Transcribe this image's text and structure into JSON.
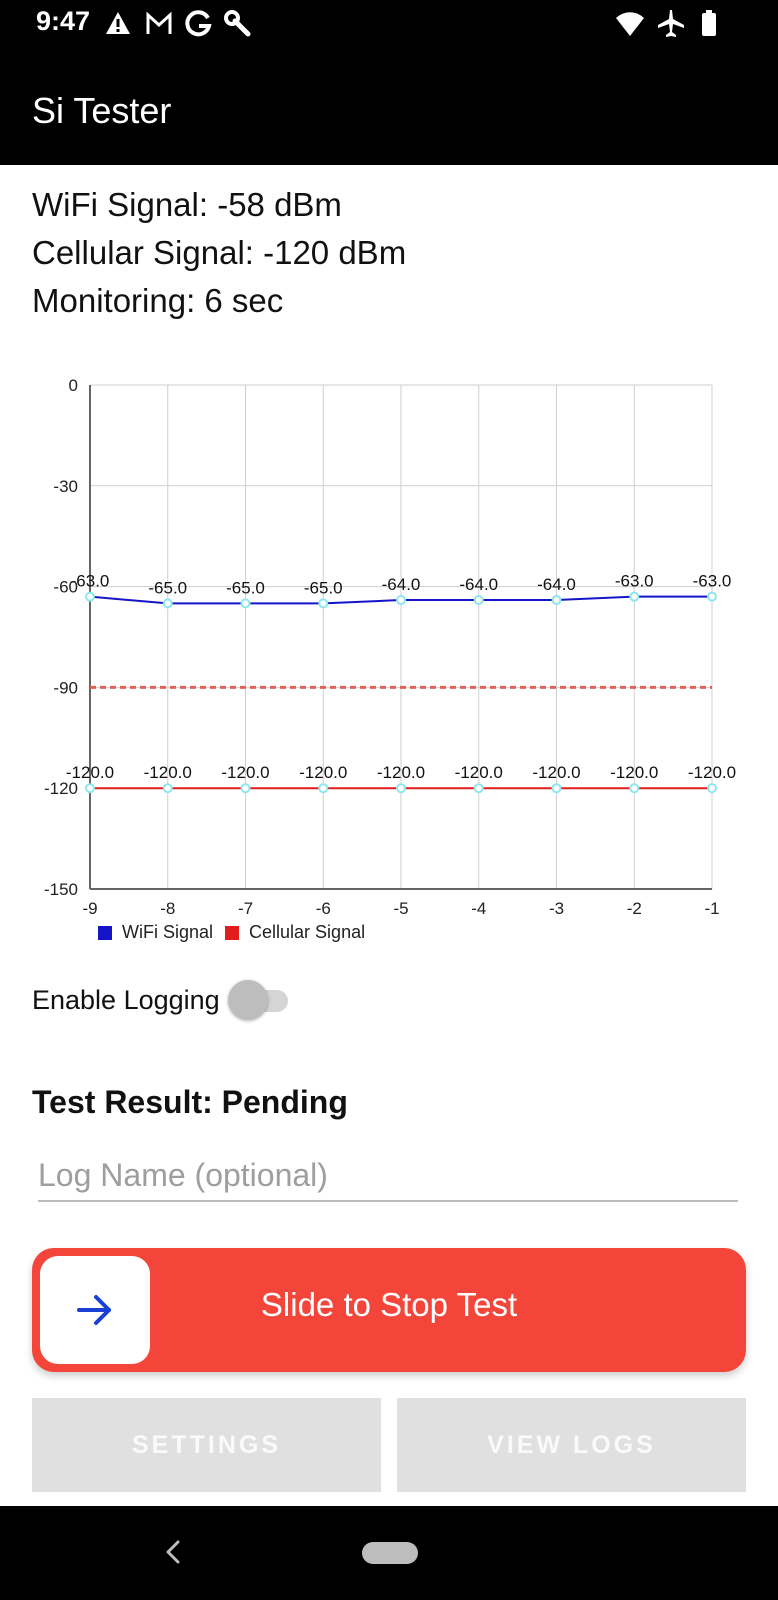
{
  "status_bar": {
    "time": "9:47",
    "left_icons": [
      "warning-icon",
      "gmail-icon",
      "google-icon",
      "wrench-icon"
    ],
    "right_icons": [
      "wifi-icon",
      "airplane-icon",
      "battery-icon"
    ]
  },
  "app_bar": {
    "title": "Si Tester"
  },
  "info": {
    "wifi": "WiFi Signal: -58 dBm",
    "cellular": "Cellular Signal: -120 dBm",
    "monitoring": "Monitoring: 6 sec"
  },
  "chart_data": {
    "type": "line",
    "x": [
      -9,
      -8,
      -7,
      -6,
      -5,
      -4,
      -3,
      -2,
      -1
    ],
    "xlim": [
      -9,
      -1
    ],
    "ylim": [
      -150,
      0
    ],
    "yticks": [
      0,
      -30,
      -60,
      -90,
      -120,
      -150
    ],
    "grid": true,
    "legend_position": "bottom-left",
    "series": [
      {
        "name": "WiFi Signal",
        "color": "#1414c8",
        "values": [
          -63.0,
          -65.0,
          -65.0,
          -65.0,
          -64.0,
          -64.0,
          -64.0,
          -63.0,
          -63.0
        ],
        "labels": [
          "-63.0",
          "-65.0",
          "-65.0",
          "-65.0",
          "-64.0",
          "-64.0",
          "-64.0",
          "-63.0",
          "-63.0"
        ]
      },
      {
        "name": "Cellular Signal",
        "color": "#e31c1c",
        "values": [
          -120.0,
          -120.0,
          -120.0,
          -120.0,
          -120.0,
          -120.0,
          -120.0,
          -120.0,
          -120.0
        ],
        "labels": [
          "-120.0",
          "-120.0",
          "-120.0",
          "-120.0",
          "-120.0",
          "-120.0",
          "-120.0",
          "-120.0",
          "-120.0"
        ]
      }
    ],
    "threshold": {
      "value": -90,
      "style": "dashed",
      "color": "#e0605a"
    },
    "marker_color": "#8ee6f0"
  },
  "logging": {
    "label": "Enable Logging",
    "enabled": false
  },
  "test_result": "Test Result: Pending",
  "log_name": {
    "placeholder": "Log Name (optional)",
    "value": ""
  },
  "slider": {
    "label": "Slide to Stop Test",
    "color": "#f4453a",
    "arrow_color": "#1a3fd6"
  },
  "buttons": {
    "settings": "SETTINGS",
    "view_logs": "VIEW LOGS"
  }
}
